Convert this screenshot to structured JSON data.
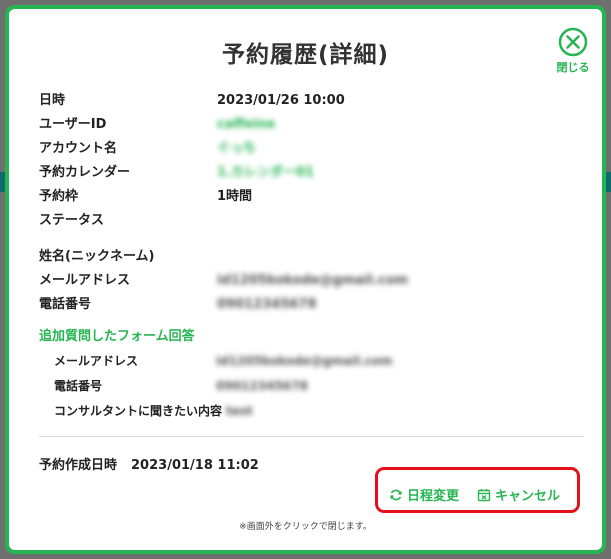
{
  "modal": {
    "title": "予約履歴(詳細)",
    "close_label": "閉じる"
  },
  "details": [
    {
      "label": "日時",
      "value": "2023/01/26 10:00"
    },
    {
      "label": "ユーザーID",
      "value": "caffeine"
    },
    {
      "label": "アカウント名",
      "value": "ぐっち"
    },
    {
      "label": "予約カレンダー",
      "value": "1.カレンダー01"
    },
    {
      "label": "予約枠",
      "value": "1時間"
    },
    {
      "label": "ステータス",
      "value": ""
    }
  ],
  "contact": [
    {
      "label": "姓名(ニックネーム)",
      "value": ""
    },
    {
      "label": "メールアドレス",
      "value": "id1205kokode@gmail.com"
    },
    {
      "label": "電話番号",
      "value": "09012345678"
    }
  ],
  "form_section": {
    "title": "追加質問したフォーム回答",
    "items": [
      {
        "label": "メールアドレス",
        "value": "id1205kokode@gmail.com"
      },
      {
        "label": "電話番号",
        "value": "09012345678"
      },
      {
        "label": "コンサルタントに聞きたい内容",
        "value": "test"
      }
    ]
  },
  "created": {
    "label": "予約作成日時",
    "value": "2023/01/18 11:02"
  },
  "actions": {
    "reschedule_label": "日程変更",
    "cancel_label": "キャンセル"
  },
  "hint": "※画面外をクリックで閉じます。",
  "colors": {
    "accent": "#27b553",
    "highlight": "#e4101a"
  }
}
